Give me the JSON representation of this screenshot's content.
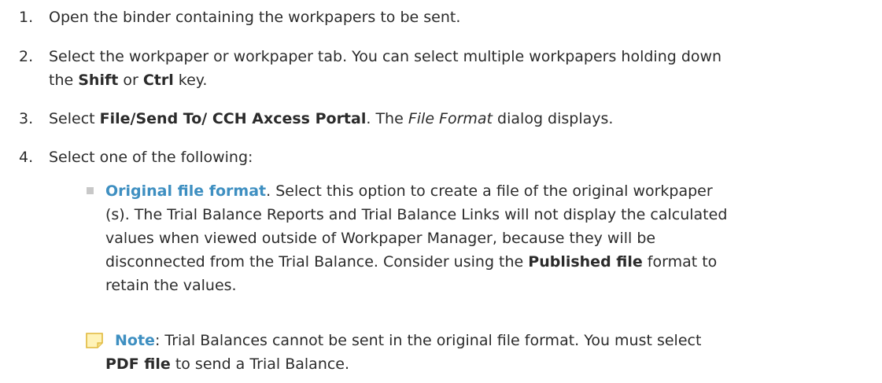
{
  "steps": [
    {
      "number": "1.",
      "text": "Open the binder containing the workpapers to be sent."
    },
    {
      "number": "2.",
      "text_before": "Select the workpaper or workpaper tab. You can select multiple workpapers holding down",
      "text_line2_before": "the ",
      "bold1": "Shift",
      "text_mid": " or ",
      "bold2": "Ctrl",
      "text_after": " key."
    },
    {
      "number": "3.",
      "text_before": "Select ",
      "bold": "File/Send To/ CCH Axcess Portal",
      "text_mid": ". The ",
      "italic": "File Format",
      "text_after": "  dialog displays."
    },
    {
      "number": "4.",
      "text": "Select one of the following:"
    }
  ],
  "bullet_item": {
    "link_label": "Original file format",
    "line1_after": ". Select this option to create a file of the original workpaper",
    "line2": "(s). The Trial Balance Reports and Trial Balance Links will not display the calculated",
    "line3": "values when viewed outside of Workpaper Manager, because they will be",
    "line4_before": "disconnected from the Trial Balance. Consider using the ",
    "line4_bold": "Published file",
    "line4_after": " format to",
    "line5": "retain the values."
  },
  "note": {
    "icon": "note-icon",
    "label": "Note",
    "line1_after": ": Trial Balances cannot be sent in the original file format. You must select",
    "line2_bold": "PDF file",
    "line2_after": " to send a Trial Balance."
  },
  "colors": {
    "text": "#2b2b2b",
    "accent_blue": "#3e8fc1",
    "bullet": "#c8c8c8",
    "note_fill": "#fff3b8",
    "note_border": "#e0b83a"
  }
}
